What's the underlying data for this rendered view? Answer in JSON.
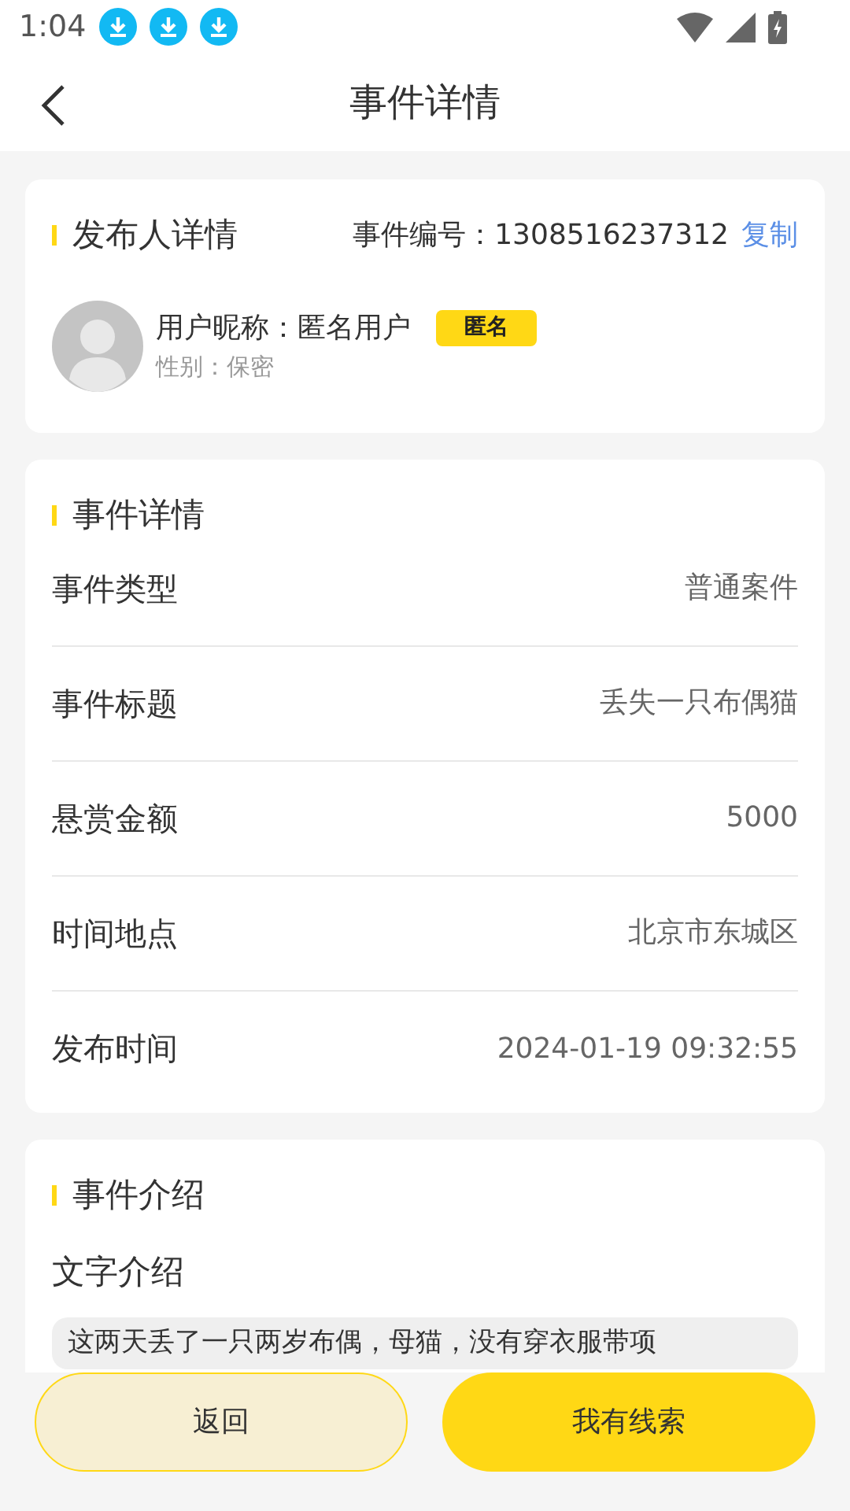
{
  "status_bar": {
    "time": "1:04",
    "notifications": [
      {
        "kind": "download"
      },
      {
        "kind": "download"
      },
      {
        "kind": "download"
      }
    ]
  },
  "header": {
    "title": "事件详情"
  },
  "publisher": {
    "title": "发布人详情",
    "event_number": "事件编号：1308516237312",
    "copy_link": "复制",
    "nickname": "用户昵称：匿名用户",
    "badge": "匿名",
    "gender": "性别：保密"
  },
  "details": {
    "title": "事件详情",
    "rows": [
      {
        "label": "事件类型",
        "value": "普通案件"
      },
      {
        "label": "事件标题",
        "value": "丢失一只布偶猫"
      },
      {
        "label": "悬赏金额",
        "value": "5000"
      },
      {
        "label": "时间地点",
        "value": "北京市东城区"
      },
      {
        "label": "发布时间",
        "value": "2024-01-19 09:32:55"
      }
    ]
  },
  "intro": {
    "title": "事件介绍",
    "subtitle": "文字介绍",
    "text": "这两天丢了一只两岁布偶，母猫，没有穿衣服带项"
  },
  "buttons": [
    {
      "label": "返回",
      "kind": "secondary"
    },
    {
      "label": "我有线索",
      "kind": "primary"
    }
  ]
}
